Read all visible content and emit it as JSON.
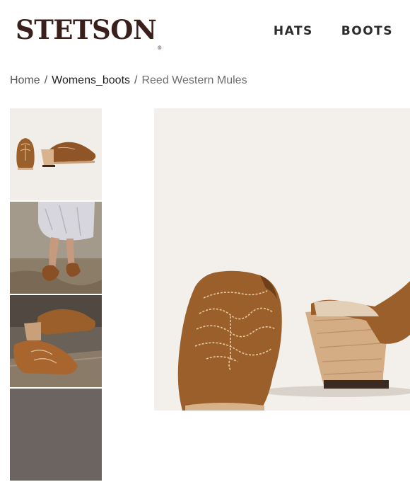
{
  "brand": {
    "logo_text": "STETSON",
    "registered_mark": "®",
    "color": "#3a1f1d"
  },
  "nav": {
    "items": [
      {
        "label": "HATS"
      },
      {
        "label": "BOOTS"
      }
    ]
  },
  "breadcrumb": {
    "items": [
      {
        "label": "Home"
      },
      {
        "label": "Womens_boots"
      },
      {
        "label": "Reed Western Mules"
      }
    ],
    "separator": "/"
  },
  "gallery": {
    "thumbnails": [
      {
        "icon": "mule-pair-product-photo"
      },
      {
        "icon": "model-wearing-mules-photo"
      },
      {
        "icon": "mules-on-wood-closeup-photo"
      },
      {
        "icon": "additional-photo"
      }
    ],
    "main_image": {
      "icon": "suede-western-mule-photo"
    }
  },
  "colors": {
    "suede": "#9a5f2a",
    "heel_wood": "#d8b592",
    "hero_bg": "#f3efea"
  }
}
